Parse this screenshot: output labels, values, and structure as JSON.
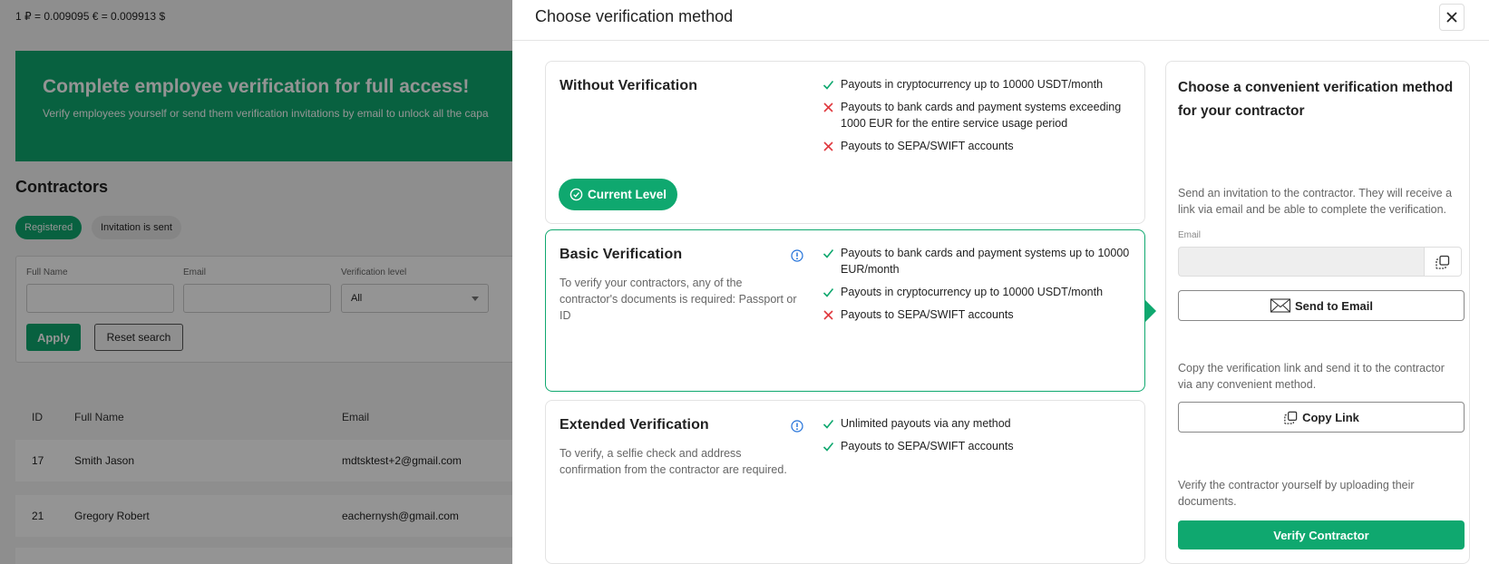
{
  "background": {
    "rate": "1 ₽ = 0.009095 € = 0.009913 $",
    "banner": {
      "title": "Complete employee verification for full access!",
      "text": "Verify employees yourself or send them verification invitations by email to unlock all the capa"
    },
    "contractors_title": "Contractors",
    "tabs": [
      "Registered",
      "Invitation is sent"
    ],
    "filters": {
      "full_name_label": "Full Name",
      "email_label": "Email",
      "verification_level_label": "Verification level",
      "verification_level_value": "All",
      "apply": "Apply",
      "reset": "Reset search"
    },
    "table": {
      "headers": [
        "ID",
        "Full Name",
        "Email"
      ],
      "rows": [
        {
          "id": "17",
          "name": "Smith Jason",
          "email": "mdtsktest+2@gmail.com"
        },
        {
          "id": "21",
          "name": "Gregory Robert",
          "email": "eachernysh@gmail.com"
        }
      ]
    }
  },
  "modal": {
    "title": "Choose verification method",
    "cards": [
      {
        "title": "Without Verification",
        "desc": "",
        "features": [
          {
            "ok": true,
            "text": "Payouts in cryptocurrency up to 10000 USDT/month"
          },
          {
            "ok": false,
            "text": "Payouts to bank cards and payment systems exceeding 1000 EUR for the entire service usage period"
          },
          {
            "ok": false,
            "text": "Payouts to SEPA/SWIFT accounts"
          }
        ],
        "current_label": "Current Level"
      },
      {
        "title": "Basic Verification",
        "desc": "To verify your contractors, any of the contractor's documents is required: Passport or ID",
        "features": [
          {
            "ok": true,
            "text": "Payouts to bank cards and payment systems up to 10000 EUR/month"
          },
          {
            "ok": true,
            "text": "Payouts in cryptocurrency up to 10000 USDT/month"
          },
          {
            "ok": false,
            "text": "Payouts to SEPA/SWIFT accounts"
          }
        ]
      },
      {
        "title": "Extended Verification",
        "desc": "To verify, a selfie check and address confirmation from the contractor are required.",
        "features": [
          {
            "ok": true,
            "text": "Unlimited payouts via any method"
          },
          {
            "ok": true,
            "text": "Payouts to SEPA/SWIFT accounts"
          }
        ]
      }
    ],
    "side": {
      "title": "Choose a convenient verification method for your contractor",
      "invite_text": "Send an invitation to the contractor. They will receive a link via email and be able to complete the verification.",
      "email_label": "Email",
      "email_value": "",
      "send_email": "Send to Email",
      "copy_text": "Copy the verification link and send it to the contractor via any convenient method.",
      "copy_link": "Copy Link",
      "self_text": "Verify the contractor yourself by uploading their documents.",
      "verify": "Verify Contractor"
    }
  },
  "colors": {
    "accent": "#0fa86f",
    "error": "#e0383e",
    "info": "#1e6fd9"
  }
}
